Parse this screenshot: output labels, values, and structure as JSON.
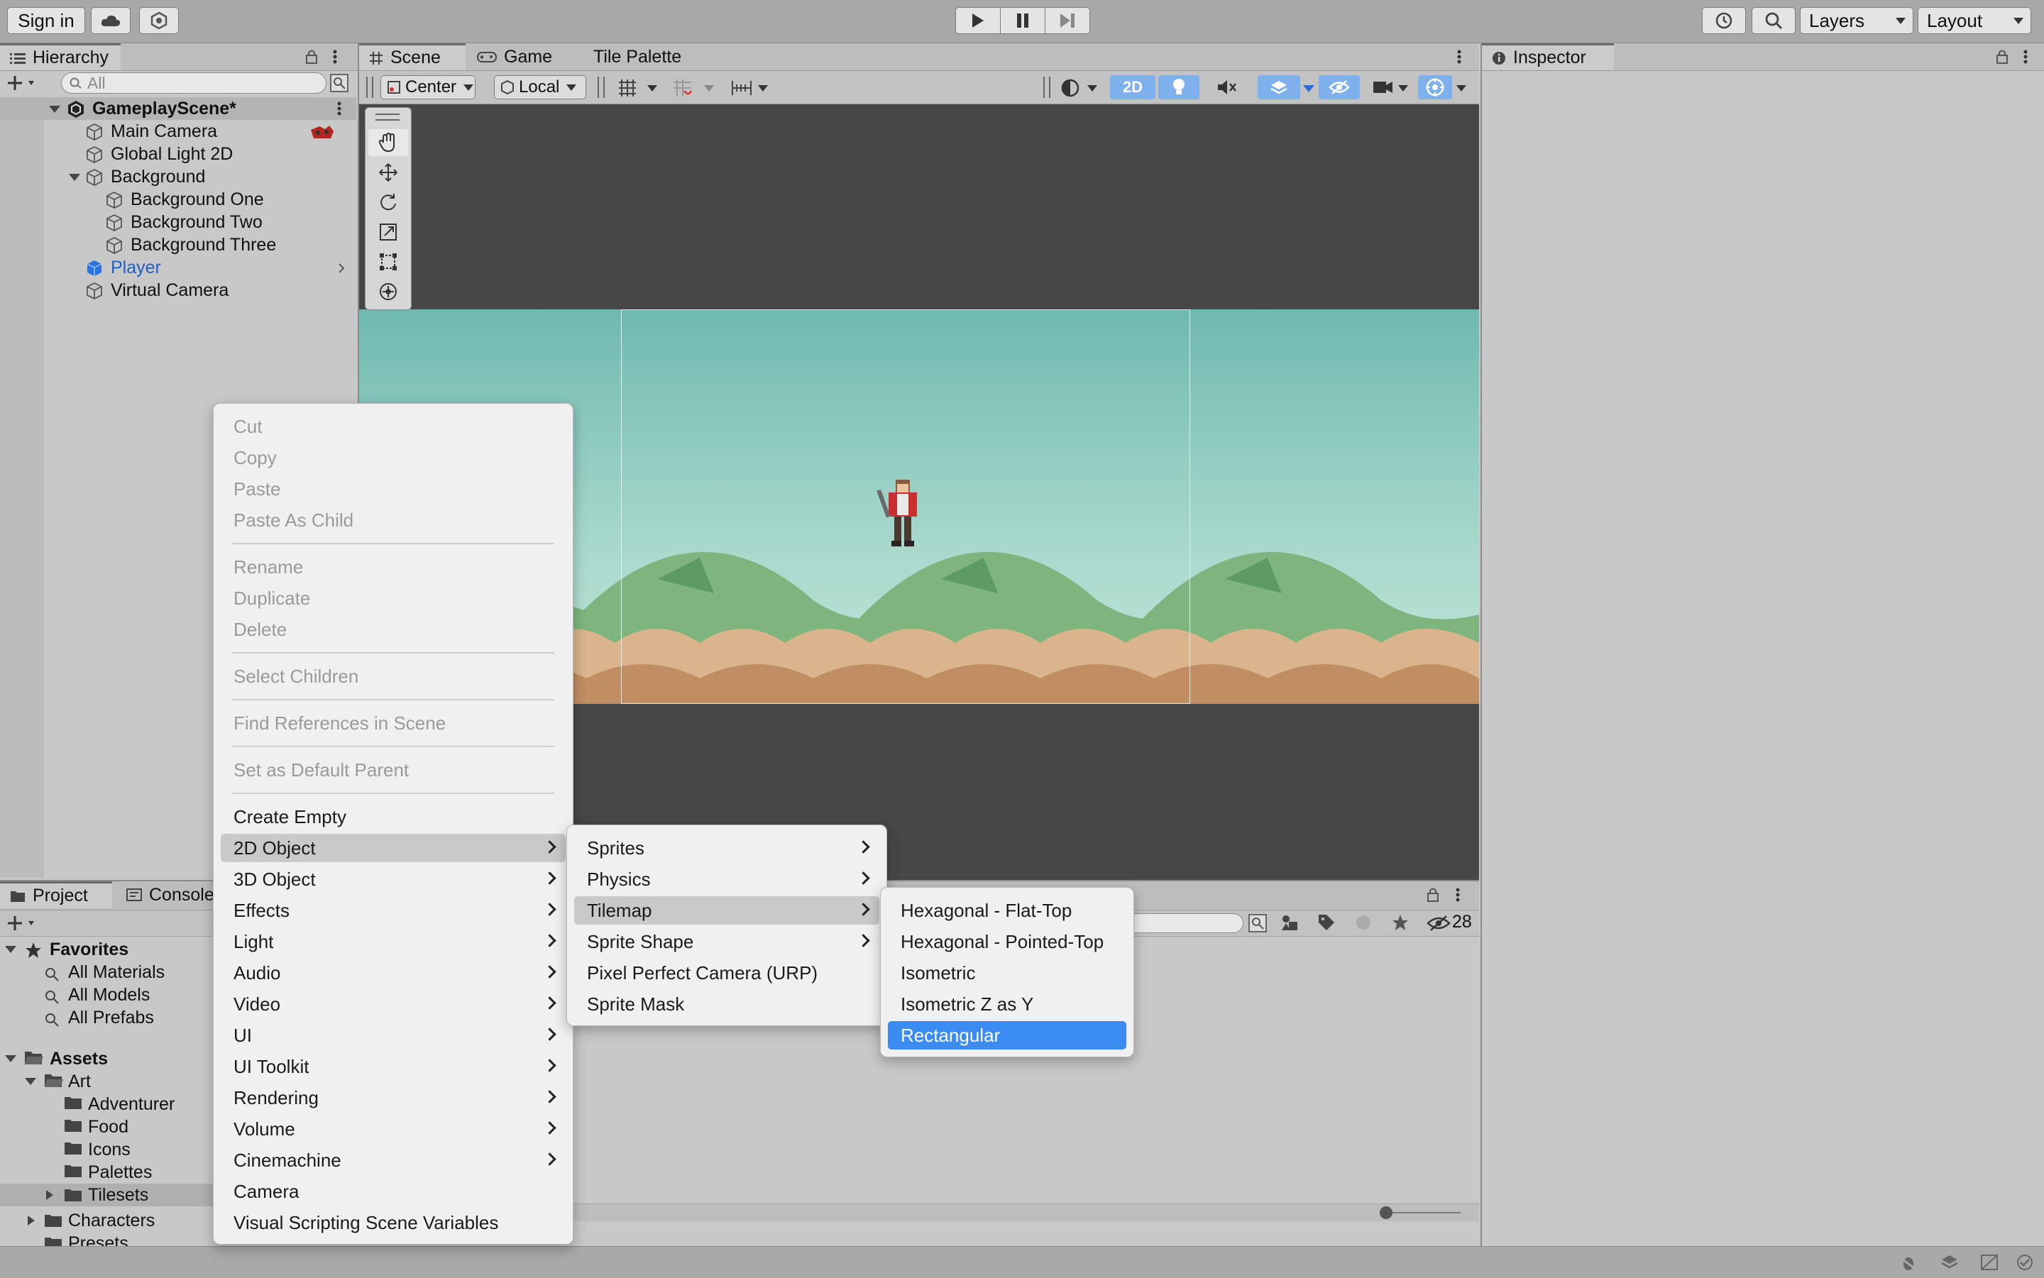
{
  "toolbar": {
    "sign_in": "Sign in",
    "layers": "Layers",
    "layout": "Layout"
  },
  "hierarchy": {
    "tab": "Hierarchy",
    "search_placeholder": "All",
    "scene": "GameplayScene*",
    "items": [
      {
        "label": "Main Camera"
      },
      {
        "label": "Global Light 2D"
      },
      {
        "label": "Background"
      },
      {
        "label": "Background One"
      },
      {
        "label": "Background Two"
      },
      {
        "label": "Background Three"
      },
      {
        "label": "Player"
      },
      {
        "label": "Virtual Camera"
      }
    ]
  },
  "scene_view": {
    "tabs": [
      "Scene",
      "Game",
      "Tile Palette"
    ],
    "pivot": "Center",
    "space": "Local",
    "mode_2d": "2D"
  },
  "inspector": {
    "tab": "Inspector"
  },
  "project": {
    "tabs": [
      "Project",
      "Console"
    ],
    "favorites": "Favorites",
    "favorite_items": [
      "All Materials",
      "All Models",
      "All Prefabs"
    ],
    "assets": "Assets",
    "art": "Art",
    "art_items": [
      "Adventurer",
      "Food",
      "Icons",
      "Palettes",
      "Tilesets"
    ],
    "more": [
      "Characters",
      "Presets"
    ],
    "hidden_count": "28"
  },
  "context_menu": {
    "items": [
      "Cut",
      "Copy",
      "Paste",
      "Paste As Child",
      "Rename",
      "Duplicate",
      "Delete",
      "Select Children",
      "Find References in Scene",
      "Set as Default Parent",
      "Create Empty",
      "2D Object",
      "3D Object",
      "Effects",
      "Light",
      "Audio",
      "Video",
      "UI",
      "UI Toolkit",
      "Rendering",
      "Volume",
      "Cinemachine",
      "Camera",
      "Visual Scripting Scene Variables"
    ]
  },
  "submenu_2d": {
    "items": [
      "Sprites",
      "Physics",
      "Tilemap",
      "Sprite Shape",
      "Pixel Perfect Camera (URP)",
      "Sprite Mask"
    ]
  },
  "submenu_tilemap": {
    "items": [
      "Hexagonal - Flat-Top",
      "Hexagonal - Pointed-Top",
      "Isometric",
      "Isometric Z as Y",
      "Rectangular"
    ]
  },
  "colors": {
    "accent": "#3b8cf2",
    "player_label": "#1f5fc4",
    "scene_bg": "#474747"
  }
}
